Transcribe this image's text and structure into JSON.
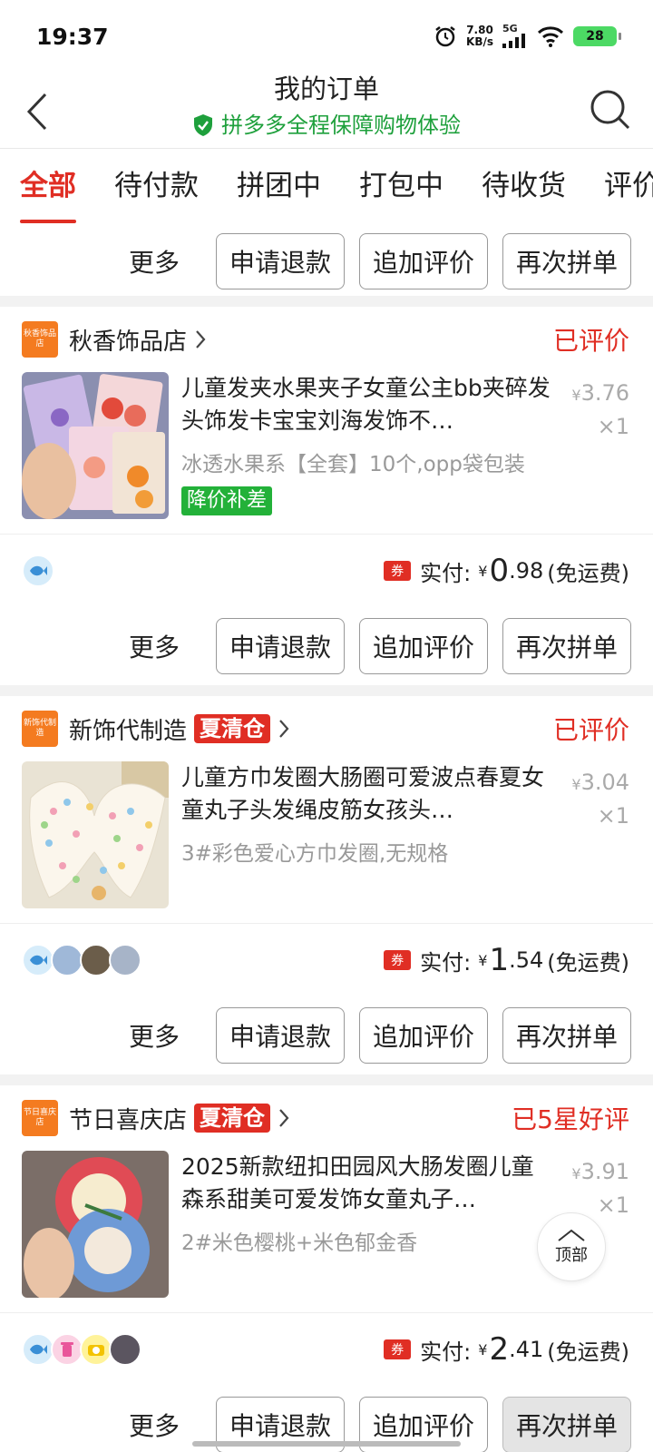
{
  "status_bar": {
    "time": "19:37",
    "net_speed_value": "7.80",
    "net_speed_unit": "KB/s",
    "network": "5G",
    "battery": "28"
  },
  "nav": {
    "title": "我的订单",
    "subtitle": "拼多多全程保障购物体验"
  },
  "tabs": [
    "全部",
    "待付款",
    "拼团中",
    "打包中",
    "待收货",
    "评价"
  ],
  "actions": {
    "more": "更多",
    "refund": "申请退款",
    "add_review": "追加评价",
    "reorder": "再次拼单"
  },
  "orders": [
    {
      "shop_logo": "秋香饰品店",
      "shop_name": "秋香饰品店",
      "promo_tag": "",
      "status": "已评价",
      "title": "儿童发夹水果夹子女童公主bb夹碎发头饰发卡宝宝刘海发饰不…",
      "spec": "冰透水果系【全套】10个,opp袋包装",
      "badge": "降价补差",
      "price": "3.76",
      "qty": "×1",
      "coupon": "券",
      "paid_label": "实付:",
      "paid_int": "0",
      "paid_dec": ".98",
      "shipping": "(免运费)"
    },
    {
      "shop_logo": "新饰代制造",
      "shop_name": "新饰代制造",
      "promo_tag": "夏清仓",
      "status": "已评价",
      "title": "儿童方巾发圈大肠圈可爱波点春夏女童丸子头发绳皮筋女孩头…",
      "spec": "3#彩色爱心方巾发圈,无规格",
      "badge": "",
      "price": "3.04",
      "qty": "×1",
      "coupon": "券",
      "paid_label": "实付:",
      "paid_int": "1",
      "paid_dec": ".54",
      "shipping": "(免运费)"
    },
    {
      "shop_logo": "节日喜庆店",
      "shop_name": "节日喜庆店",
      "promo_tag": "夏清仓",
      "status": "已5星好评",
      "title": "2025新款纽扣田园风大肠发圈儿童森系甜美可爱发饰女童丸子…",
      "spec": "2#米色樱桃+米色郁金香",
      "badge": "",
      "price": "3.91",
      "qty": "×1",
      "coupon": "券",
      "paid_label": "实付:",
      "paid_int": "2",
      "paid_dec": ".41",
      "shipping": "(免运费)"
    }
  ],
  "back_to_top": "顶部",
  "colors": {
    "accent": "#e02e24",
    "green": "#1ea03c",
    "shop_logo": "#f47b20"
  }
}
